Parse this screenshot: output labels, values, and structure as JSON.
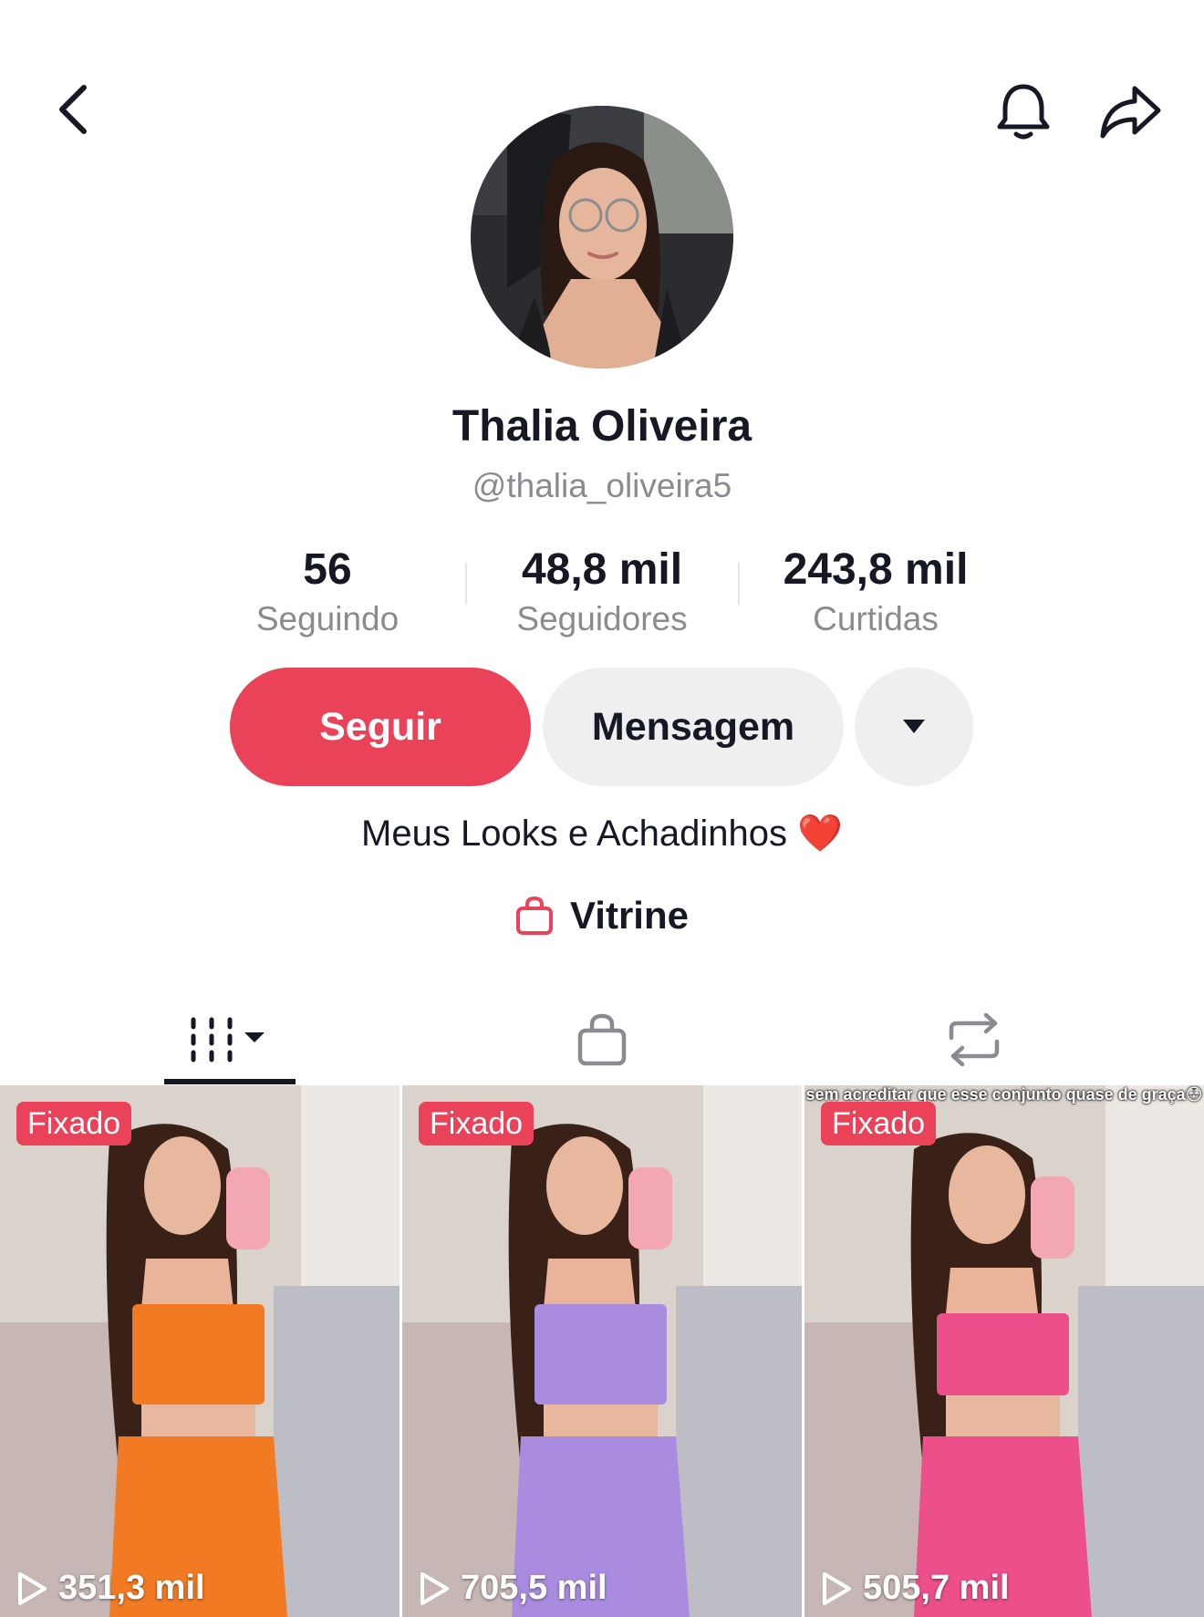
{
  "profile": {
    "name": "Thalia Oliveira",
    "handle": "@thalia_oliveira5",
    "bio": "Meus Looks e Achadinhos ❤️"
  },
  "stats": [
    {
      "value": "56",
      "label": "Seguindo"
    },
    {
      "value": "48,8 mil",
      "label": "Seguidores"
    },
    {
      "value": "243,8 mil",
      "label": "Curtidas"
    }
  ],
  "actions": {
    "follow": "Seguir",
    "message": "Mensagem"
  },
  "showcase": {
    "label": "Vitrine"
  },
  "tabs": [
    {
      "icon": "videos-grid-icon",
      "active": true
    },
    {
      "icon": "shopping-bag-icon",
      "active": false
    },
    {
      "icon": "repost-icon",
      "active": false
    }
  ],
  "videos": [
    {
      "badge": "Fixado",
      "views": "351,3 mil",
      "outfit_color": "#f27a22",
      "caption": ""
    },
    {
      "badge": "Fixado",
      "views": "705,5 mil",
      "outfit_color": "#a98ce0",
      "caption": ""
    },
    {
      "badge": "Fixado",
      "views": "505,7 mil",
      "outfit_color": "#ec4f8a",
      "caption": "sem acreditar que esse conjunto quase de graça😳"
    }
  ],
  "colors": {
    "accent": "#ea4359",
    "secondary_text": "#8a8b91",
    "button_gray": "#efeff0"
  }
}
